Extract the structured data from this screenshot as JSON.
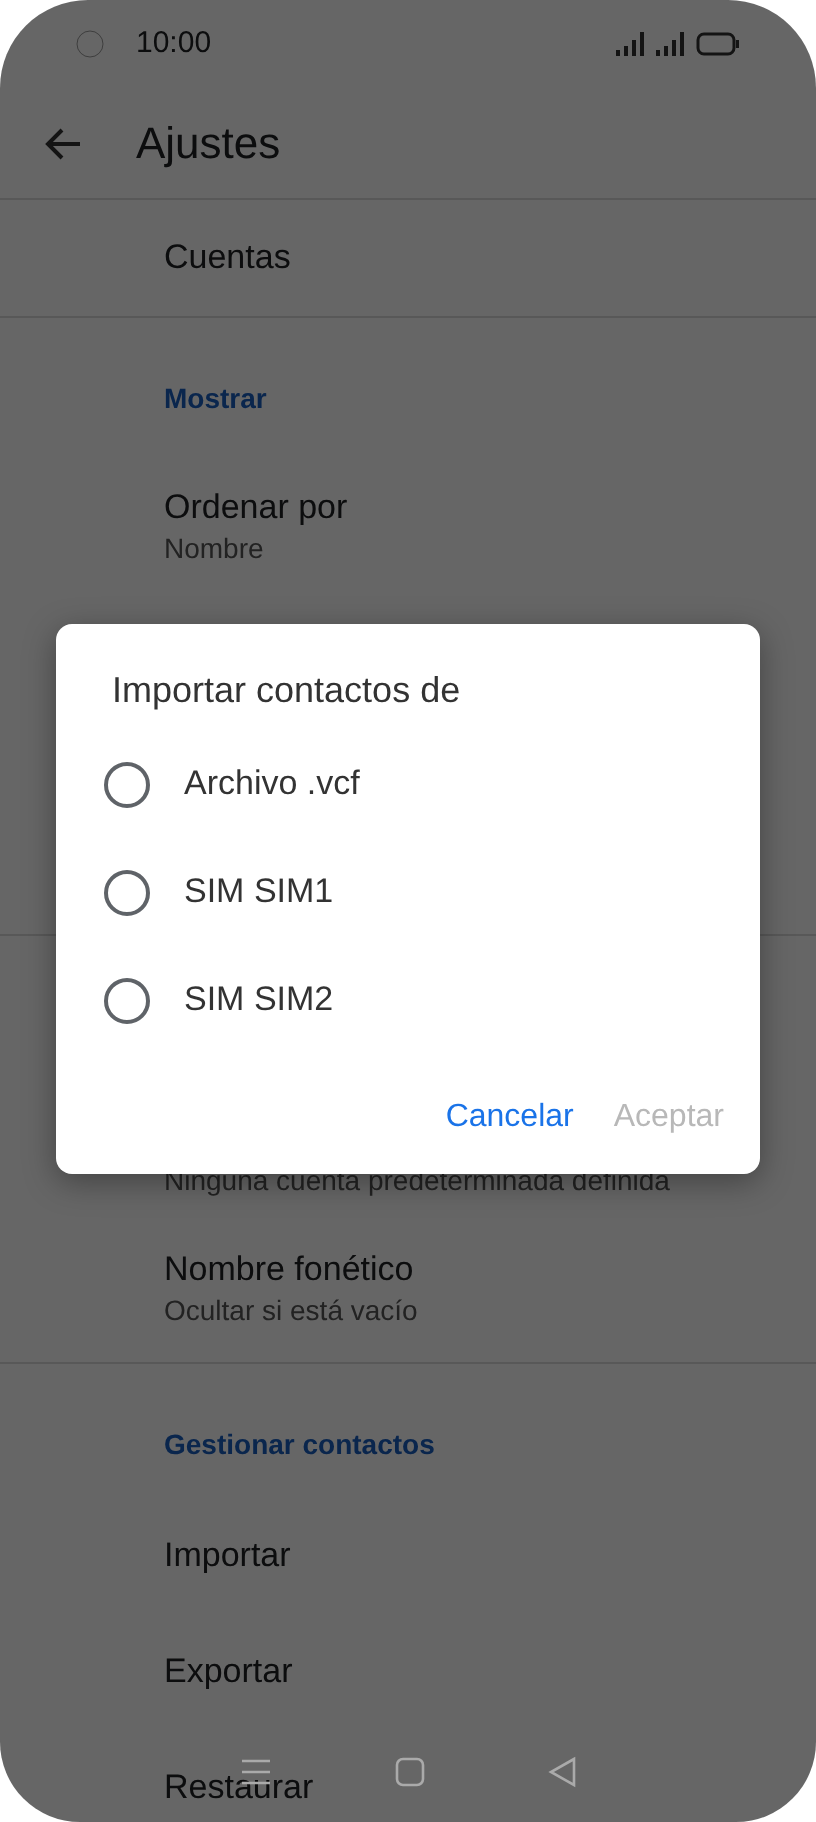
{
  "status_bar": {
    "time": "10:00"
  },
  "app_bar": {
    "title": "Ajustes"
  },
  "settings_top": [
    {
      "kind": "item",
      "title": "Cuentas"
    },
    {
      "kind": "header",
      "title": "Mostrar"
    },
    {
      "kind": "item",
      "title": "Ordenar por",
      "summary": "Nombre"
    }
  ],
  "settings_bottom": [
    {
      "kind": "partial",
      "summary": "Ninguna cuenta predeterminada definida"
    },
    {
      "kind": "item",
      "title": "Nombre fonético",
      "summary": "Ocultar si está vacío"
    },
    {
      "kind": "header",
      "title": "Gestionar contactos"
    },
    {
      "kind": "item",
      "title": "Importar"
    },
    {
      "kind": "item",
      "title": "Exportar"
    },
    {
      "kind": "item",
      "title": "Restaurar"
    }
  ],
  "dialog": {
    "title": "Importar contactos de",
    "options": [
      {
        "label": "Archivo .vcf",
        "selected": false
      },
      {
        "label": "SIM SIM1",
        "selected": false
      },
      {
        "label": "SIM SIM2",
        "selected": false
      }
    ],
    "buttons": [
      {
        "label": "Cancelar",
        "disabled": false
      },
      {
        "label": "Aceptar",
        "disabled": true
      }
    ]
  }
}
